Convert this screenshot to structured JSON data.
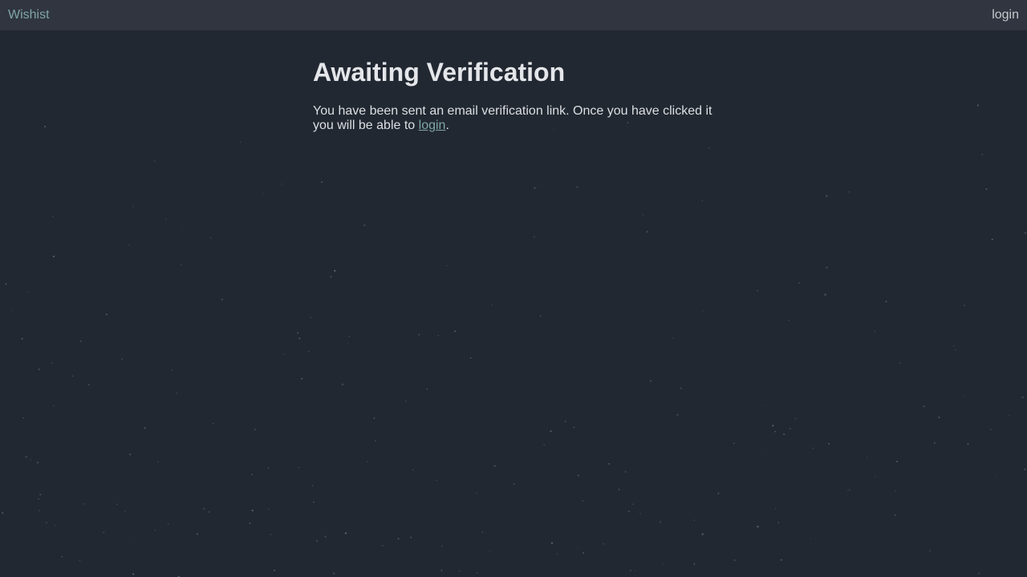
{
  "theme": {
    "background": "#222831",
    "navbar_background": "#30353f",
    "accent": "#7fa6a8",
    "text": "#e4e6ea"
  },
  "navbar": {
    "brand": "Wishist",
    "login_label": "login"
  },
  "main": {
    "title": "Awaiting Verification",
    "message_before": "You have been sent an email verification link. Once you have clicked it you will be able to ",
    "message_link": "login",
    "message_after": "."
  }
}
